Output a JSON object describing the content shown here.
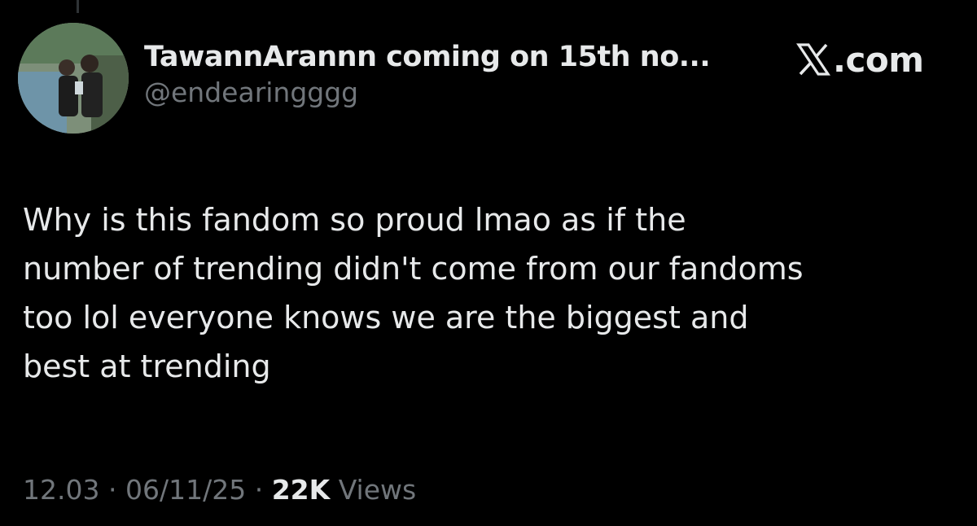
{
  "post": {
    "display_name": "TawannArannn coming on 15th no...",
    "handle": "@endearingggg",
    "brand": {
      "icon": "x-logo-icon",
      "suffix": ".com"
    },
    "text_lines": [
      "Why is this fandom so proud lmao as if the",
      "number of trending didn't come from our fandoms",
      "too lol everyone knows we are the biggest and",
      "best at trending"
    ],
    "time": "12.03",
    "separator": "·",
    "date": "06/11/25",
    "views_count": "22K",
    "views_label": "Views"
  },
  "colors": {
    "background": "#000000",
    "primary_text": "#e7e9ea",
    "secondary_text": "#71767b"
  }
}
